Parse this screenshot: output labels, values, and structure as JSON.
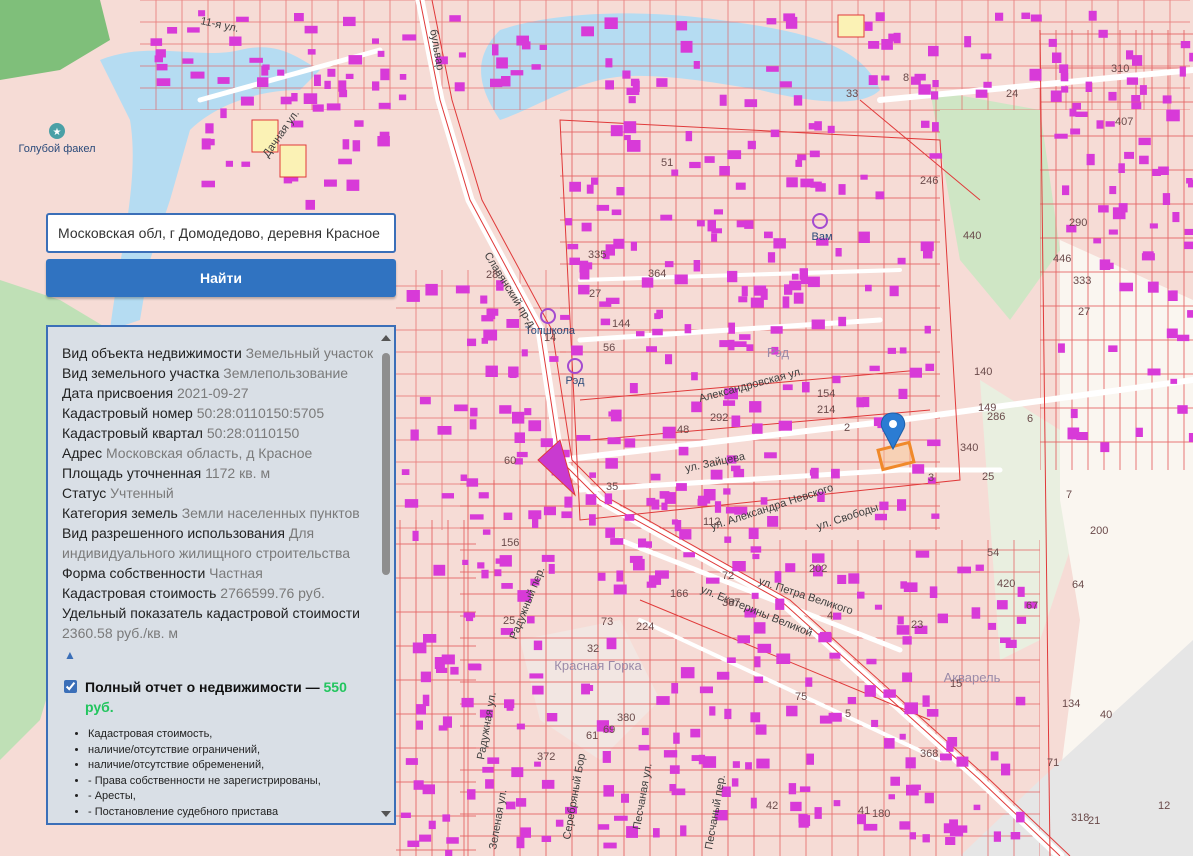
{
  "search": {
    "value": "Московская обл, г Домодедово, деревня Красное",
    "button_label": "Найти"
  },
  "info": {
    "rows": [
      {
        "label": "Вид объекта недвижимости",
        "value": "Земельный участок"
      },
      {
        "label": "Вид земельного участка",
        "value": "Землепользование"
      },
      {
        "label": "Дата присвоения",
        "value": "2021-09-27"
      },
      {
        "label": "Кадастровый номер",
        "value": "50:28:0110150:5705"
      },
      {
        "label": "Кадастровый квартал",
        "value": "50:28:0110150"
      },
      {
        "label": "Адрес",
        "value": "Московская область, д Красное"
      },
      {
        "label": "Площадь уточненная",
        "value": "1172 кв. м"
      },
      {
        "label": "Статус",
        "value": "Учтенный"
      },
      {
        "label": "Категория земель",
        "value": "Земли населенных пунктов"
      },
      {
        "label": "Вид разрешенного использования",
        "value": "Для индивидуального жилищного строительства"
      },
      {
        "label": "Форма собственности",
        "value": "Частная"
      },
      {
        "label": "Кадастровая стоимость",
        "value": "2766599.76 руб."
      },
      {
        "label": "Удельный показатель кадастровой стоимости",
        "value": "2360.58 руб./кв. м"
      }
    ],
    "collapse_arrow": "▲",
    "report": {
      "checked": true,
      "title": "Полный отчет о недвижимости —",
      "price": "550 руб.",
      "items": [
        "Кадастровая стоимость,",
        "наличие/отсутствие ограничений,",
        "наличие/отсутствие обременений,",
        "- Права собственности не зарегистрированы,",
        "- Аресты,",
        "- Постановление судебного пристава"
      ]
    }
  },
  "map": {
    "poi": [
      {
        "name": "Голубой факел"
      },
      {
        "name": "Топшкола"
      },
      {
        "name": "Рэд"
      },
      {
        "name": "Вам"
      }
    ],
    "streets": [
      "Дачная ул.",
      "Славянский пр-д",
      "Александровская ул.",
      "ул. Зайцева",
      "ул. Александра Невского",
      "ул. Свободы",
      "ул. Петра Великого",
      "ул. Екатерины Великой",
      "Радужный пер.",
      "Радужная ул.",
      "Серебряный Бор",
      "Песчаная ул.",
      "Песчаный пер.",
      "Зеленая ул.",
      "11-я ул.",
      "бульвар"
    ],
    "districts": [
      "Красная Горка",
      "Акварель",
      "Рэд"
    ],
    "parcel_numbers": [
      "60",
      "112",
      "134",
      "149",
      "32",
      "64",
      "56",
      "27",
      "33",
      "54",
      "67",
      "144",
      "25",
      "51",
      "69",
      "154",
      "8",
      "71",
      "72",
      "73",
      "75",
      "3",
      "48",
      "42",
      "140",
      "166",
      "156",
      "200",
      "202",
      "246",
      "214",
      "224",
      "180",
      "333",
      "290",
      "335",
      "292",
      "340",
      "286",
      "364",
      "372",
      "368",
      "407",
      "387",
      "380",
      "440",
      "446",
      "420",
      "310",
      "318",
      "23",
      "40",
      "24",
      "27",
      "12",
      "21",
      "15",
      "4",
      "41",
      "2",
      "6",
      "14",
      "25",
      "35",
      "7",
      "5",
      "28",
      "61"
    ],
    "colors": {
      "background": "#f6dcd6",
      "boundary": "#e03a3a",
      "building": "#d83ad8",
      "water": "#b5dcf2",
      "forest": "#b7dcae",
      "selected": "#f0892a",
      "marker": "#2b7cd3"
    }
  }
}
